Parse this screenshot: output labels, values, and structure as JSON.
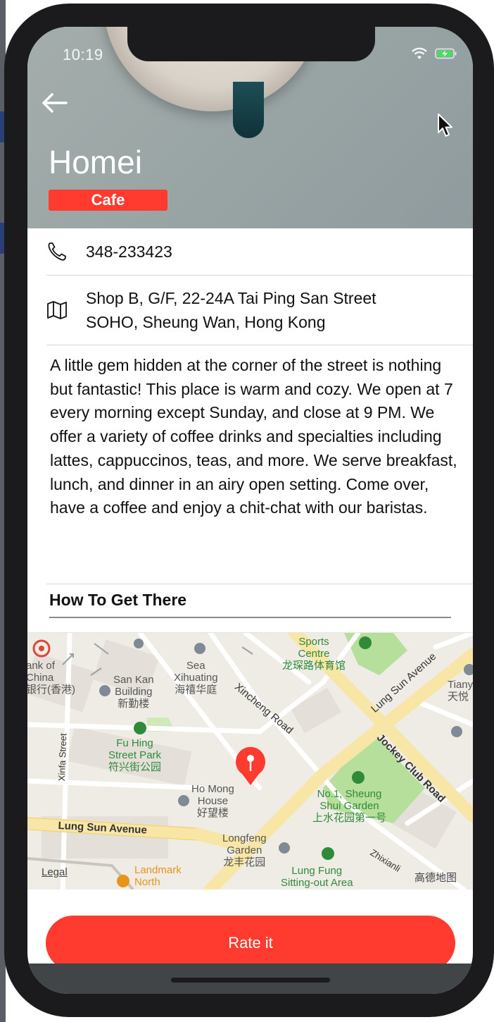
{
  "status_bar": {
    "time": "10:19",
    "wifi_icon": "wifi-icon",
    "battery_icon": "battery-charging-icon"
  },
  "header": {
    "back_icon": "arrow-left-icon",
    "title": "Homei",
    "category": "Cafe"
  },
  "details": {
    "phone_icon": "phone-icon",
    "phone": "348-233423",
    "address_icon": "map-icon",
    "address_line1": "Shop B, G/F, 22-24A Tai Ping San Street",
    "address_line2": "SOHO, Sheung Wan, Hong Kong",
    "description": "A little gem hidden at the corner of the street is nothing but fantastic! This place is warm and cozy. We open at 7 every morning except Sunday, and close at 9 PM. We offer a variety of coffee drinks and specialties including lattes, cappuccinos, teas, and more. We serve breakfast, lunch, and dinner in an airy open setting. Come over, have a coffee and enjoy a chit-chat with our baristas."
  },
  "directions": {
    "section_title": "How To Get There",
    "map": {
      "labels": {
        "bank": "ank of\nChina\n银行(香港)",
        "san_kan": "San Kan\nBuilding\n新勤楼",
        "sea_xihuating": "Sea\nXihuating\n海禧华庭",
        "sports_centre": "Sports\nCentre\n龙琛路体育馆",
        "tiany": "Tiany\n天悦",
        "fu_hing": "Fu Hing\nStreet Park\n符兴街公园",
        "ho_mong": "Ho Mong\nHouse\n好望楼",
        "no1_sheung_shui": "No.1, Sheung\nShui Garden\n上水花园第一号",
        "longfeng": "Longfeng\nGarden\n龙丰花园",
        "lung_fung": "Lung Fung\nSitting-out Area",
        "landmark_north": "Landmark\nNorth",
        "xincheng_road": "Xincheng Road",
        "lung_sun_avenue_top": "Lung Sun Avenue",
        "jockey_club_road": "Jockey Club Road",
        "xinfa_street": "Xinfa Street",
        "lung_sun_avenue": "Lung Sun Avenue",
        "zhixianli": "Zhixianli",
        "legal": "Legal",
        "amap_logo": "高德地图"
      },
      "pin_icon": "map-pin-icon",
      "colors": {
        "base": "#efece6",
        "major_road": "#f8e6a6",
        "park": "#b7df9c",
        "pin": "#ff3b30"
      }
    }
  },
  "actions": {
    "rate_label": "Rate it"
  },
  "colors": {
    "accent": "#ff3b30",
    "text": "#111111",
    "divider": "#d9d9d9"
  }
}
